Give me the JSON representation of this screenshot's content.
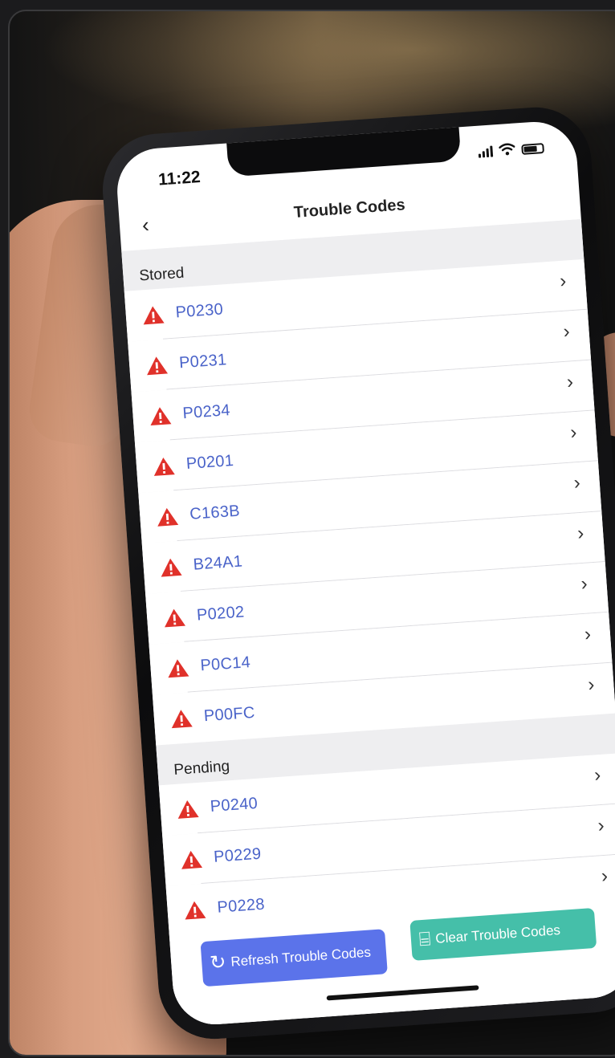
{
  "status_bar": {
    "time": "11:22",
    "icons": [
      "cellular-signal-icon",
      "wifi-icon",
      "battery-icon"
    ]
  },
  "nav": {
    "back_icon": "chevron-left-icon",
    "back_glyph": "‹",
    "title": "Trouble Codes"
  },
  "sections": {
    "stored": {
      "title": "Stored",
      "codes": [
        "P0230",
        "P0231",
        "P0234",
        "P0201",
        "C163B",
        "B24A1",
        "P0202",
        "P0C14",
        "P00FC"
      ]
    },
    "pending": {
      "title": "Pending",
      "codes": [
        "P0240",
        "P0229",
        "P0228"
      ]
    }
  },
  "row_icon": "warning-triangle-icon",
  "row_chevron": "›",
  "buttons": {
    "refresh": {
      "label": "Refresh Trouble Codes",
      "icon": "refresh-icon",
      "glyph": "↻"
    },
    "clear": {
      "label": "Clear Trouble Codes",
      "icon": "broom-icon",
      "glyph": "⌸"
    }
  },
  "colors": {
    "code_text": "#4a63c9",
    "warning": "#e0312a",
    "refresh_button": "#5b73ea",
    "clear_button": "#45bfa9"
  }
}
